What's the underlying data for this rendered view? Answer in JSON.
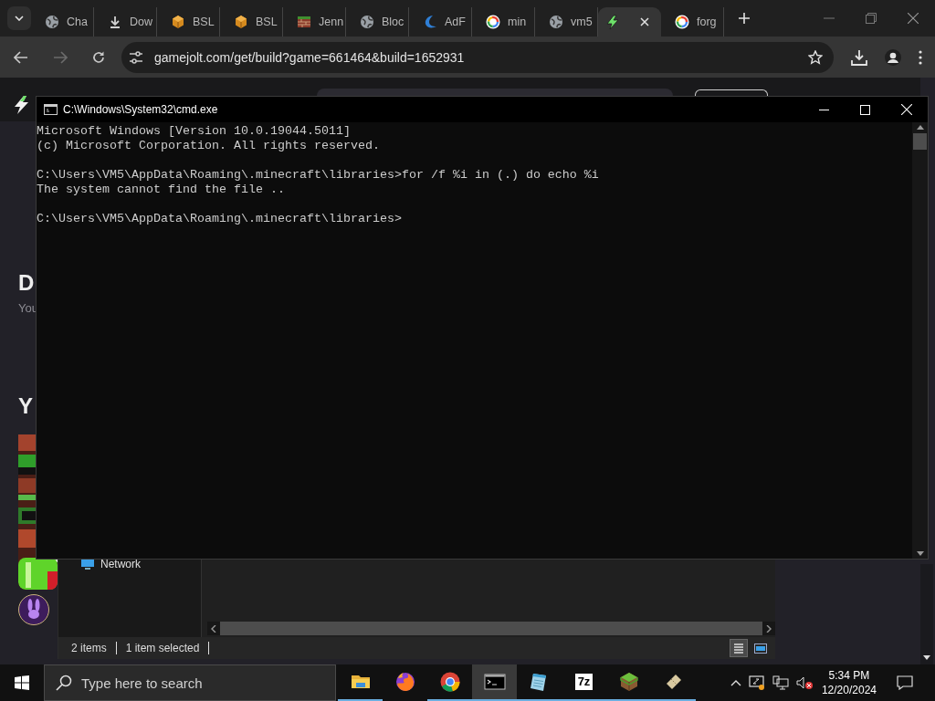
{
  "browser": {
    "tabs": [
      {
        "kind": "globe",
        "label": "Cha",
        "selected": false
      },
      {
        "kind": "download",
        "label": "Dow",
        "selected": false
      },
      {
        "kind": "cube",
        "label": "BSL",
        "selected": false
      },
      {
        "kind": "cube",
        "label": "BSL",
        "selected": false
      },
      {
        "kind": "bricks",
        "label": "Jenn",
        "selected": false
      },
      {
        "kind": "globe",
        "label": "Bloc",
        "selected": false
      },
      {
        "kind": "swoosh",
        "label": "AdF",
        "selected": false
      },
      {
        "kind": "ring",
        "label": "min",
        "selected": false
      },
      {
        "kind": "globe",
        "label": "vm5",
        "selected": false
      },
      {
        "kind": "bolt",
        "selected": true
      },
      {
        "kind": "ring",
        "label": "forg",
        "selected": false
      }
    ],
    "address": "gamejolt.com/get/build?game=661464&build=1652931"
  },
  "page": {
    "heading": "D",
    "subtitle": "You",
    "section": "Y"
  },
  "explorer": {
    "nav_items": [
      {
        "label": "Network"
      }
    ],
    "status_items": [
      "2 items",
      "1 item selected"
    ],
    "views": [
      {
        "kind": "details",
        "selected": true
      },
      {
        "kind": "tiles",
        "selected": false
      }
    ]
  },
  "console": {
    "title": "C:\\Windows\\System32\\cmd.exe",
    "blocks": [
      [
        "Microsoft Windows [Version 10.0.19044.5011]",
        "(c) Microsoft Corporation. All rights reserved."
      ],
      [
        "C:\\Users\\VM5\\AppData\\Roaming\\.minecraft\\libraries>for /f %i in (.) do echo %i",
        "The system cannot find the file .."
      ],
      [
        "C:\\Users\\VM5\\AppData\\Roaming\\.minecraft\\libraries>"
      ]
    ]
  },
  "taskbar": {
    "search_placeholder": "Type here to search",
    "apps": [
      {
        "kind": "folder",
        "running": true,
        "selected": false
      },
      {
        "kind": "fox",
        "running": false,
        "selected": false
      },
      {
        "kind": "browser",
        "running": true,
        "selected": false
      },
      {
        "kind": "terminal",
        "running": true,
        "selected": true
      },
      {
        "kind": "notepad",
        "running": true,
        "selected": false
      },
      {
        "kind": "archive",
        "label": "7z",
        "running": true,
        "selected": false
      },
      {
        "kind": "block",
        "running": true,
        "selected": false
      },
      {
        "kind": "ticket",
        "running": true,
        "selected": false
      }
    ],
    "time": "5:34 PM",
    "date": "12/20/2024"
  }
}
